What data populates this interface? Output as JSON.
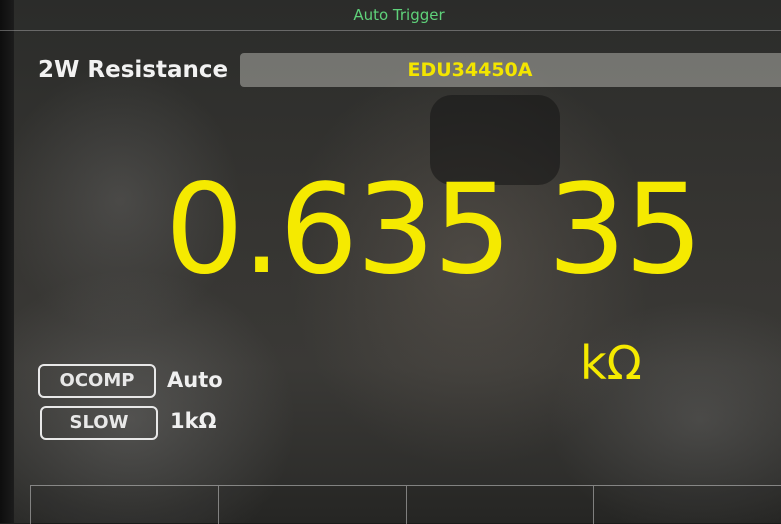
{
  "header": {
    "trigger_status": "Auto Trigger"
  },
  "measurement": {
    "mode": "2W Resistance",
    "model": "EDU34450A",
    "reading": "0.635 35",
    "unit": "kΩ"
  },
  "settings": {
    "ocomp": {
      "label": "OCOMP",
      "value": "Auto"
    },
    "slow": {
      "label": "SLOW",
      "value": "1kΩ"
    }
  },
  "softkeys": [
    "",
    "",
    "",
    ""
  ],
  "colors": {
    "reading": "#f5ea00",
    "trigger_text": "#5fd27a",
    "label": "#f2f2f2"
  }
}
